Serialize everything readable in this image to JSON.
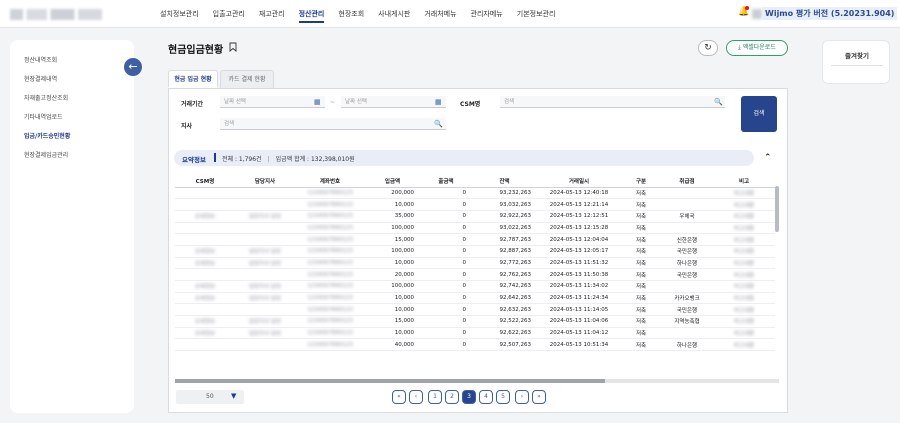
{
  "header": {
    "nav": [
      "설치정보관리",
      "입출고관리",
      "재고관리",
      "정산관리",
      "현장조회",
      "사내게시판",
      "거래처메뉴",
      "관리자메뉴",
      "기본정보관리"
    ],
    "active_nav": "정산관리",
    "version_badge": "Wijmo 평가 버전 (5.20231.904)"
  },
  "sidebar": {
    "items": [
      "정산내역조회",
      "현장결제내역",
      "자재출고정산조회",
      "기타내역업로드",
      "입금/카드승인현황",
      "현장결제입금관리"
    ],
    "active_index": 4
  },
  "favorites": {
    "title": "즐겨찾기"
  },
  "page": {
    "title": "현금입금현황",
    "excel_label": "엑셀다운로드",
    "tabs": [
      "현금 입금 현황",
      "카드 결제 현황"
    ],
    "active_tab": 0
  },
  "search": {
    "period_label": "거래기간",
    "date_from_placeholder": "날짜 선택",
    "date_to_placeholder": "날짜 선택",
    "tilde": "~",
    "csm_label": "CSM명",
    "csm_placeholder": "검색",
    "branch_label": "지사",
    "branch_placeholder": "검색",
    "button_label": "검색"
  },
  "summary": {
    "label": "요약정보",
    "total": "전체 : 1,796건",
    "amount": "입금액 합계 : 132,398,010원"
  },
  "table": {
    "columns": [
      "CSM명",
      "담당지사",
      "계좌번호",
      "입금액",
      "출금액",
      "잔액",
      "거래일시",
      "구분",
      "취급점",
      "비고"
    ],
    "rows": [
      {
        "csm": "",
        "branch": "",
        "account": "blur",
        "in": "200,000",
        "out": "0",
        "balance": "93,232,263",
        "datetime": "2024-05-13 12:40:18",
        "type": "저축",
        "bank": "",
        "note": "blur"
      },
      {
        "csm": "",
        "branch": "",
        "account": "blur",
        "in": "10,000",
        "out": "0",
        "balance": "93,032,263",
        "datetime": "2024-05-13 12:21:14",
        "type": "저축",
        "bank": "",
        "note": "blur"
      },
      {
        "csm": "blur",
        "branch": "blur",
        "account": "blur",
        "in": "35,000",
        "out": "0",
        "balance": "92,922,263",
        "datetime": "2024-05-13 12:12:51",
        "type": "저축",
        "bank": "우체국",
        "note": "blur"
      },
      {
        "csm": "",
        "branch": "",
        "account": "blur",
        "in": "100,000",
        "out": "0",
        "balance": "93,022,263",
        "datetime": "2024-05-13 12:15:28",
        "type": "저축",
        "bank": "",
        "note": "blur"
      },
      {
        "csm": "",
        "branch": "",
        "account": "blur",
        "in": "15,000",
        "out": "0",
        "balance": "92,787,263",
        "datetime": "2024-05-13 12:04:04",
        "type": "저축",
        "bank": "신한은행",
        "note": "blur"
      },
      {
        "csm": "blur",
        "branch": "blur",
        "account": "blur",
        "in": "100,000",
        "out": "0",
        "balance": "92,887,263",
        "datetime": "2024-05-13 12:05:17",
        "type": "저축",
        "bank": "국민은행",
        "note": "blur"
      },
      {
        "csm": "blur",
        "branch": "blur",
        "account": "blur",
        "in": "10,000",
        "out": "0",
        "balance": "92,772,263",
        "datetime": "2024-05-13 11:51:32",
        "type": "저축",
        "bank": "하나은행",
        "note": "blur"
      },
      {
        "csm": "",
        "branch": "",
        "account": "blur",
        "in": "20,000",
        "out": "0",
        "balance": "92,762,263",
        "datetime": "2024-05-13 11:50:38",
        "type": "저축",
        "bank": "국민은행",
        "note": "blur"
      },
      {
        "csm": "blur",
        "branch": "blur",
        "account": "blur",
        "in": "100,000",
        "out": "0",
        "balance": "92,742,263",
        "datetime": "2024-05-13 11:34:02",
        "type": "저축",
        "bank": "",
        "note": "blur"
      },
      {
        "csm": "blur",
        "branch": "blur",
        "account": "blur",
        "in": "10,000",
        "out": "0",
        "balance": "92,642,263",
        "datetime": "2024-05-13 11:24:34",
        "type": "저축",
        "bank": "카카오뱅크",
        "note": "blur"
      },
      {
        "csm": "",
        "branch": "",
        "account": "blur",
        "in": "10,000",
        "out": "0",
        "balance": "92,632,263",
        "datetime": "2024-05-13 11:14:05",
        "type": "저축",
        "bank": "국민은행",
        "note": "blur"
      },
      {
        "csm": "blur",
        "branch": "blur",
        "account": "blur",
        "in": "15,000",
        "out": "0",
        "balance": "92,522,263",
        "datetime": "2024-05-13 11:04:06",
        "type": "저축",
        "bank": "지역농축협",
        "note": "blur"
      },
      {
        "csm": "blur",
        "branch": "blur",
        "account": "blur",
        "in": "10,000",
        "out": "0",
        "balance": "92,622,263",
        "datetime": "2024-05-13 11:04:12",
        "type": "저축",
        "bank": "",
        "note": "blur"
      },
      {
        "csm": "",
        "branch": "",
        "account": "blur",
        "in": "40,000",
        "out": "0",
        "balance": "92,507,263",
        "datetime": "2024-05-13 10:51:34",
        "type": "저축",
        "bank": "하나은행",
        "note": "blur"
      }
    ]
  },
  "footer": {
    "page_size": "50",
    "pages": [
      "1",
      "2",
      "3",
      "4",
      "5"
    ],
    "active_page": "3"
  }
}
